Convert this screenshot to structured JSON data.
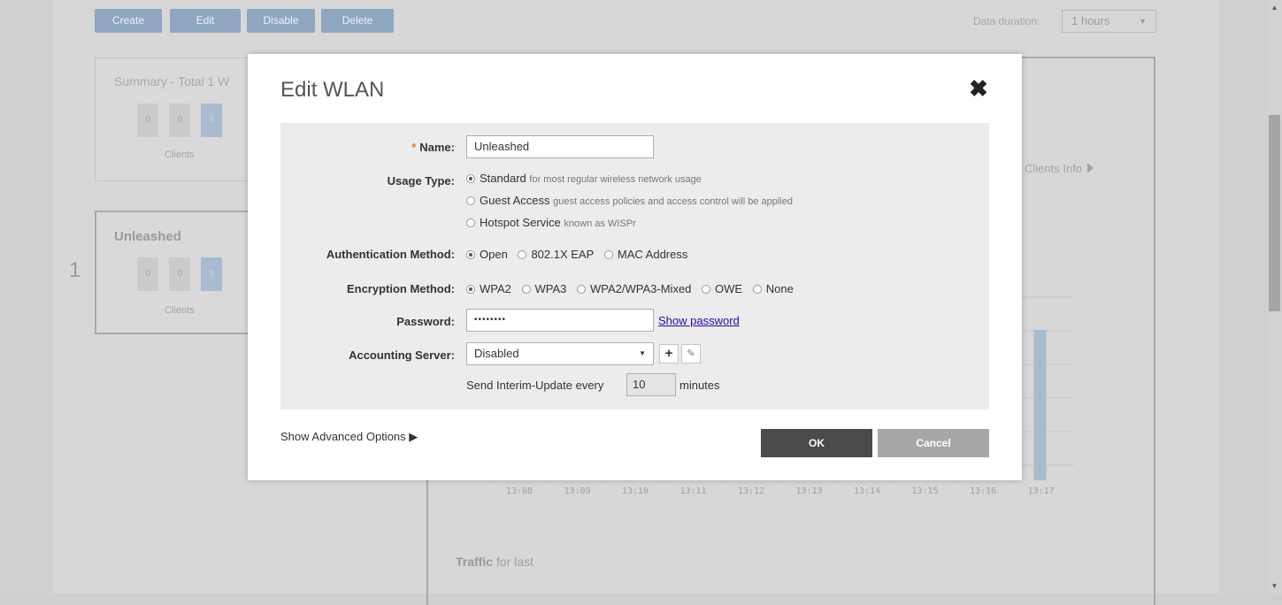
{
  "toolbar": {
    "create": "Create",
    "edit": "Edit",
    "disable": "Disable",
    "delete": "Delete"
  },
  "duration": {
    "label": "Data duration:",
    "value": "1 hours"
  },
  "summary": {
    "title": "Summary - Total 1 W",
    "cells": [
      "0",
      "0",
      "5"
    ],
    "caption": "Clients"
  },
  "wlan_card": {
    "index": "1",
    "title": "Unleashed",
    "cells": [
      "0",
      "0",
      "5"
    ],
    "caption": "Clients"
  },
  "clients_info": "Clients Info",
  "traffic": {
    "bold": "Traffic",
    "rest": " for last"
  },
  "chart_data": {
    "type": "bar",
    "categories": [
      "13:08",
      "13:09",
      "13:10",
      "13:11",
      "13:12",
      "13:13",
      "13:14",
      "13:15",
      "13:16",
      "13:17"
    ],
    "values": [
      0,
      0,
      0,
      0,
      0,
      0,
      0,
      0,
      0,
      5
    ],
    "color": "#a9bbd0"
  },
  "modal": {
    "title": "Edit WLAN",
    "name_label": "Name:",
    "name_value": "Unleashed",
    "usage_label": "Usage Type:",
    "usage_options": [
      {
        "label": "Standard",
        "desc": "for most regular wireless network usage"
      },
      {
        "label": "Guest Access",
        "desc": "guest access policies and access control will be applied"
      },
      {
        "label": "Hotspot Service",
        "desc": "known as WISPr"
      }
    ],
    "auth_label": "Authentication Method:",
    "auth_options": [
      "Open",
      "802.1X EAP",
      "MAC Address"
    ],
    "enc_label": "Encryption Method:",
    "enc_options": [
      "WPA2",
      "WPA3",
      "WPA2/WPA3-Mixed",
      "OWE",
      "None"
    ],
    "password_label": "Password:",
    "password_value": "••••••••",
    "show_password": "Show password",
    "acct_label": "Accounting Server:",
    "acct_value": "Disabled",
    "interim_prefix": "Send Interim-Update every",
    "interim_value": "10",
    "interim_suffix": "minutes",
    "advanced": "Show Advanced Options ▶",
    "ok": "OK",
    "cancel": "Cancel"
  }
}
